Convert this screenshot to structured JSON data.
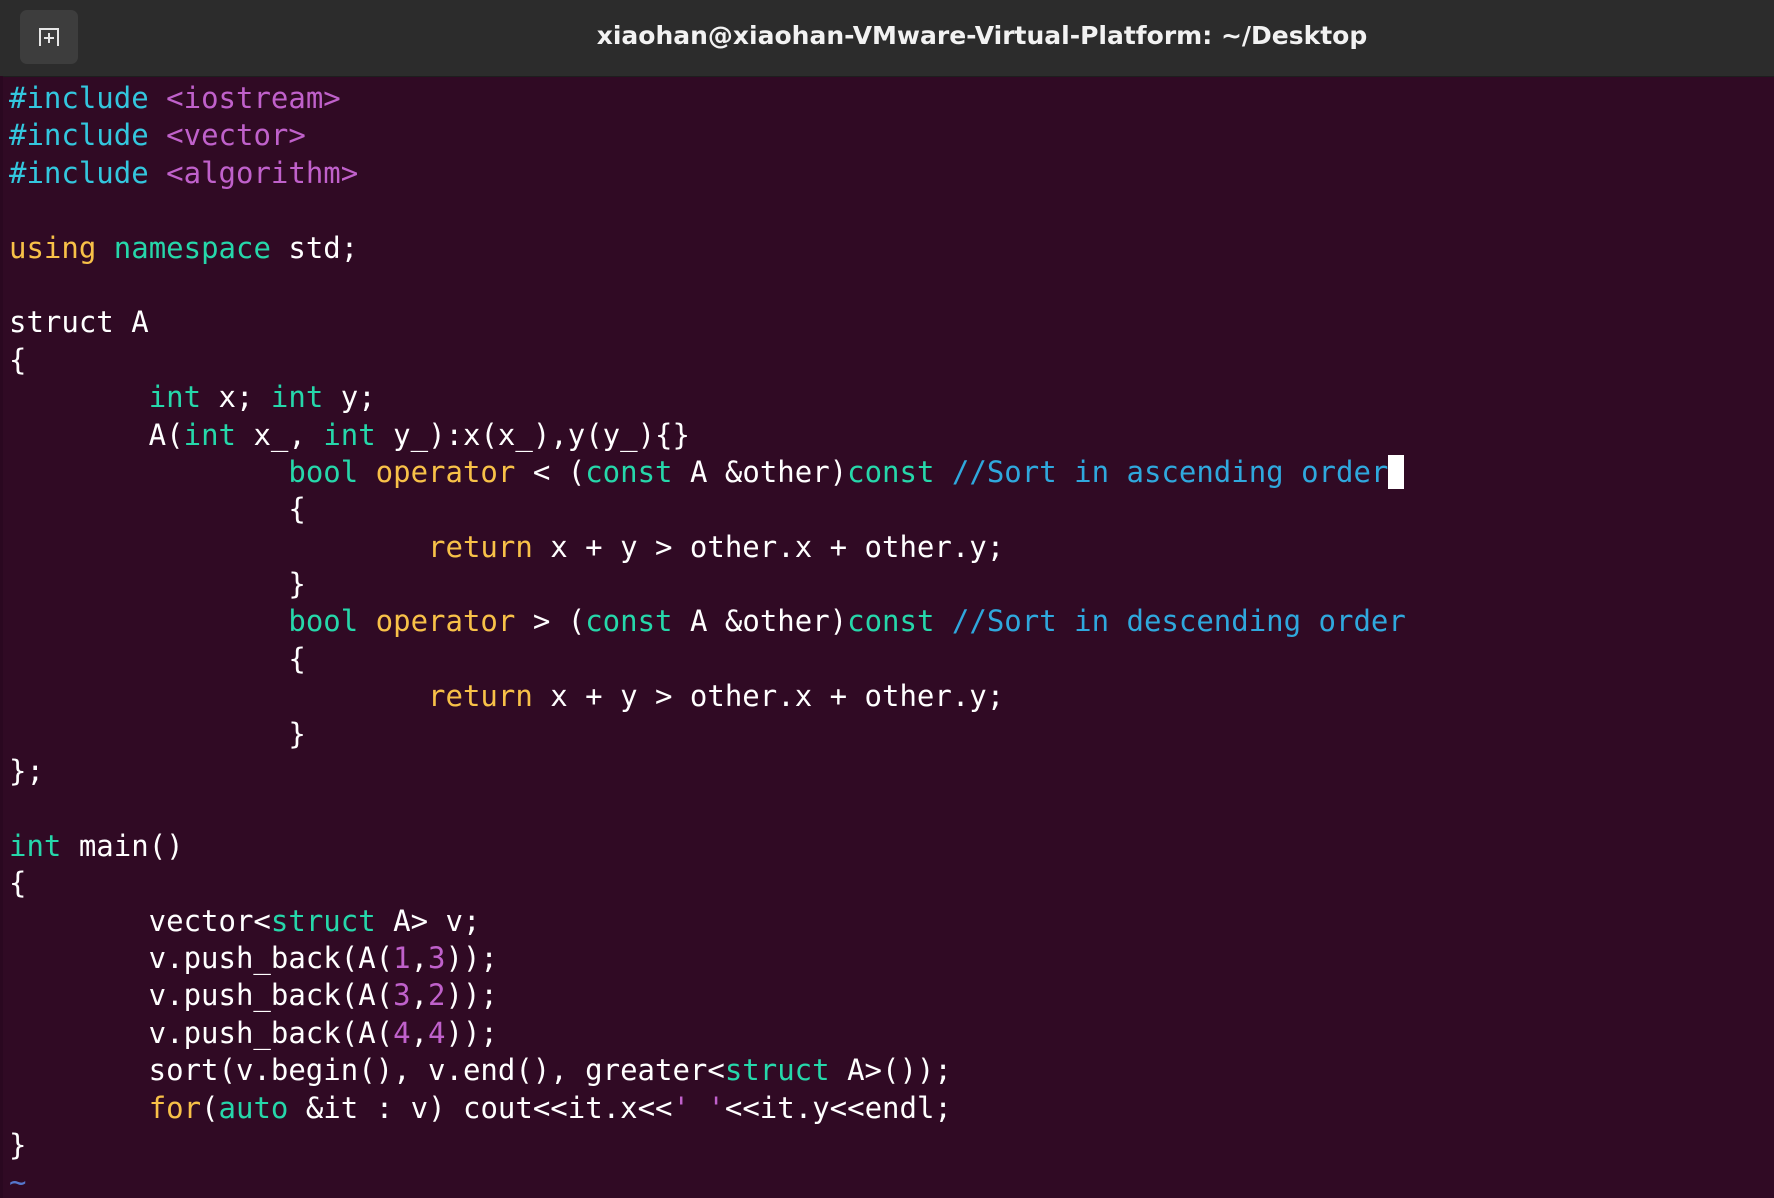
{
  "window": {
    "title": "xiaohan@xiaohan-VMware-Virtual-Platform: ~/Desktop",
    "new_tab_icon": "new-tab-icon"
  },
  "colors": {
    "background": "#300a24",
    "titlebar": "#2c2c2c",
    "preprocessor": "#33c7de",
    "include_path": "#c061cb",
    "keyword": "#f8c148",
    "type": "#26d7aa",
    "comment": "#2fa8dd",
    "number": "#c061cb"
  },
  "editor": {
    "lines": [
      [
        [
          "preproc",
          "#include"
        ],
        [
          "plain",
          " "
        ],
        [
          "include",
          "<iostream>"
        ]
      ],
      [
        [
          "preproc",
          "#include"
        ],
        [
          "plain",
          " "
        ],
        [
          "include",
          "<vector>"
        ]
      ],
      [
        [
          "preproc",
          "#include"
        ],
        [
          "plain",
          " "
        ],
        [
          "include",
          "<algorithm>"
        ]
      ],
      [],
      [
        [
          "keyword",
          "using"
        ],
        [
          "plain",
          " "
        ],
        [
          "type",
          "namespace"
        ],
        [
          "plain",
          " std;"
        ]
      ],
      [],
      [
        [
          "plain",
          "struct A"
        ]
      ],
      [
        [
          "plain",
          "{"
        ]
      ],
      [
        [
          "plain",
          "        "
        ],
        [
          "type",
          "int"
        ],
        [
          "plain",
          " x; "
        ],
        [
          "type",
          "int"
        ],
        [
          "plain",
          " y;"
        ]
      ],
      [
        [
          "plain",
          "        A("
        ],
        [
          "type",
          "int"
        ],
        [
          "plain",
          " x_, "
        ],
        [
          "type",
          "int"
        ],
        [
          "plain",
          " y_):x(x_),y(y_){}"
        ]
      ],
      [
        [
          "plain",
          "                "
        ],
        [
          "type",
          "bool"
        ],
        [
          "plain",
          " "
        ],
        [
          "keyword",
          "operator"
        ],
        [
          "plain",
          " < ("
        ],
        [
          "type",
          "const"
        ],
        [
          "plain",
          " A &other)"
        ],
        [
          "type",
          "const"
        ],
        [
          "plain",
          " "
        ],
        [
          "comment",
          "//Sort in ascending order"
        ],
        [
          "cursor",
          ""
        ]
      ],
      [
        [
          "plain",
          "                {"
        ]
      ],
      [
        [
          "plain",
          "                        "
        ],
        [
          "keyword",
          "return"
        ],
        [
          "plain",
          " x + y > other.x + other.y;"
        ]
      ],
      [
        [
          "plain",
          "                }"
        ]
      ],
      [
        [
          "plain",
          "                "
        ],
        [
          "type",
          "bool"
        ],
        [
          "plain",
          " "
        ],
        [
          "keyword",
          "operator"
        ],
        [
          "plain",
          " > ("
        ],
        [
          "type",
          "const"
        ],
        [
          "plain",
          " A &other)"
        ],
        [
          "type",
          "const"
        ],
        [
          "plain",
          " "
        ],
        [
          "comment",
          "//Sort in descending order"
        ]
      ],
      [
        [
          "plain",
          "                {"
        ]
      ],
      [
        [
          "plain",
          "                        "
        ],
        [
          "keyword",
          "return"
        ],
        [
          "plain",
          " x + y > other.x + other.y;"
        ]
      ],
      [
        [
          "plain",
          "                }"
        ]
      ],
      [
        [
          "plain",
          "};"
        ]
      ],
      [],
      [
        [
          "type",
          "int"
        ],
        [
          "plain",
          " main()"
        ]
      ],
      [
        [
          "plain",
          "{"
        ]
      ],
      [
        [
          "plain",
          "        vector<"
        ],
        [
          "type",
          "struct"
        ],
        [
          "plain",
          " A> v;"
        ]
      ],
      [
        [
          "plain",
          "        v.push_back(A("
        ],
        [
          "number",
          "1"
        ],
        [
          "plain",
          ","
        ],
        [
          "number",
          "3"
        ],
        [
          "plain",
          "));"
        ]
      ],
      [
        [
          "plain",
          "        v.push_back(A("
        ],
        [
          "number",
          "3"
        ],
        [
          "plain",
          ","
        ],
        [
          "number",
          "2"
        ],
        [
          "plain",
          "));"
        ]
      ],
      [
        [
          "plain",
          "        v.push_back(A("
        ],
        [
          "number",
          "4"
        ],
        [
          "plain",
          ","
        ],
        [
          "number",
          "4"
        ],
        [
          "plain",
          "));"
        ]
      ],
      [
        [
          "plain",
          "        sort(v.begin(), v.end(), greater<"
        ],
        [
          "type",
          "struct"
        ],
        [
          "plain",
          " A>());"
        ]
      ],
      [
        [
          "plain",
          "        "
        ],
        [
          "keyword",
          "for"
        ],
        [
          "plain",
          "("
        ],
        [
          "type",
          "auto"
        ],
        [
          "plain",
          " &it : v) cout<<it.x<<"
        ],
        [
          "string",
          "' '"
        ],
        [
          "plain",
          "<<it.y<<endl;"
        ]
      ],
      [
        [
          "plain",
          "}"
        ]
      ],
      [
        [
          "tilde",
          "~"
        ]
      ]
    ]
  }
}
